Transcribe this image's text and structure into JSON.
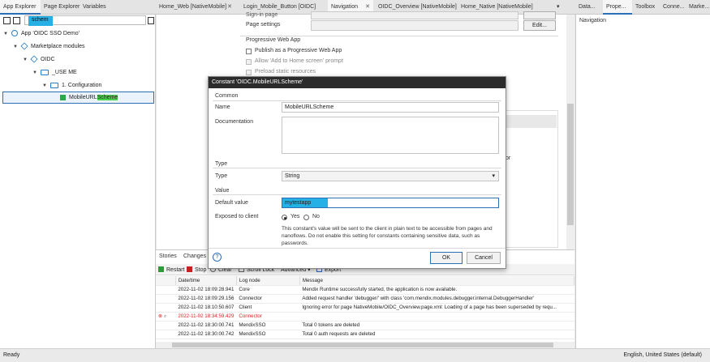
{
  "left_tabs": [
    "App Explorer",
    "Page Explorer",
    "Variables"
  ],
  "doc_tabs": [
    "Home_Web [NativeMobile]",
    "Login_Mobile_Button [OIDC]",
    "Navigation",
    "OIDC_Overview [NativeMobile]",
    "Home_Native [NativeMobile]"
  ],
  "right_tabs": [
    "Data...",
    "Prope...",
    "Toolbox",
    "Conne...",
    "Marke..."
  ],
  "right_panel_title": "Navigation",
  "search": {
    "value": "schem"
  },
  "tree": [
    {
      "label": "App 'OIDC SSO Demo'",
      "icon": "app-icon"
    },
    {
      "label": "Marketplace modules",
      "icon": "module-icon"
    },
    {
      "label": "OIDC",
      "icon": "module-icon"
    },
    {
      "label": "_USE ME",
      "icon": "folder-icon"
    },
    {
      "label": "1. Configuration",
      "icon": "folder-icon"
    },
    {
      "label_pre": "MobileURL",
      "label_hl": "Scheme",
      "icon": "constant-icon"
    }
  ],
  "doc": {
    "partial_label": "Sign-in page",
    "page_settings_label": "Page settings",
    "edit_label": "Edit...",
    "pwa_title": "Progressive Web App",
    "pwa_publish": "Publish as a Progressive Web App",
    "pwa_allow": "Allow 'Add to Home screen' prompt",
    "pwa_preload": "Preload static resources",
    "partial_or": "or"
  },
  "dialog": {
    "title": "Constant 'OIDC.MobileURLScheme'",
    "common_title": "Common",
    "name_label": "Name",
    "name_value": "MobileURLScheme",
    "doc_label": "Documentation",
    "type_title": "Type",
    "type_label": "Type",
    "type_value": "String",
    "value_title": "Value",
    "default_label": "Default value",
    "default_value": "mytestapp",
    "exposed_label": "Exposed to client",
    "yes": "Yes",
    "no": "No",
    "note": "This constant's value will be sent to the client in plain text to be accessible from pages and nanoflows. Do not enable this setting for constants containing sensitive data, such as passwords.",
    "ok": "OK",
    "cancel": "Cancel"
  },
  "console": {
    "tabs": [
      "Stories",
      "Changes"
    ],
    "toolbar": {
      "restart": "Restart",
      "stop": "Stop",
      "clear": "Clear",
      "scroll_lock": "Scroll Lock",
      "advanced": "Advanced",
      "export": "Export"
    },
    "columns": [
      "Date/time",
      "Log node",
      "Message"
    ],
    "rows": [
      {
        "time": "2022-11-02 18:09:28.941",
        "node": "Core",
        "message": "Mendix Runtime successfully started, the application is now available.",
        "error": false
      },
      {
        "time": "2022-11-02 18:09:29.156",
        "node": "Connector",
        "message": "Added request handler 'debugger/' with class 'com.mendix.modules.debugger.internal.DebuggerHandler'",
        "error": false
      },
      {
        "time": "2022-11-02 18:10:50.607",
        "node": "Client",
        "message": "Ignoring error for page NativeMobile/OIDC_Overview.page.xml: Loading of a page has been superseded by requ...",
        "error": false
      },
      {
        "time": "2022-11-02 18:34:59.429",
        "node": "Connector",
        "message": "",
        "error": true
      },
      {
        "time": "2022-11-02 18:30:00.741",
        "node": "MendixSSO",
        "message": "Total 0 tokens are deleted",
        "error": false
      },
      {
        "time": "2022-11-02 18:30:00.742",
        "node": "MendixSSO",
        "message": "Total 0 auth requests are deleted",
        "error": false
      }
    ]
  },
  "status": {
    "left": "Ready",
    "right": "English, United States (default)"
  },
  "colors": {
    "search_highlight": "#27b0e6",
    "tree_highlight": "#46d54a",
    "accent": "#2d6fb5",
    "error": "#d22222"
  }
}
